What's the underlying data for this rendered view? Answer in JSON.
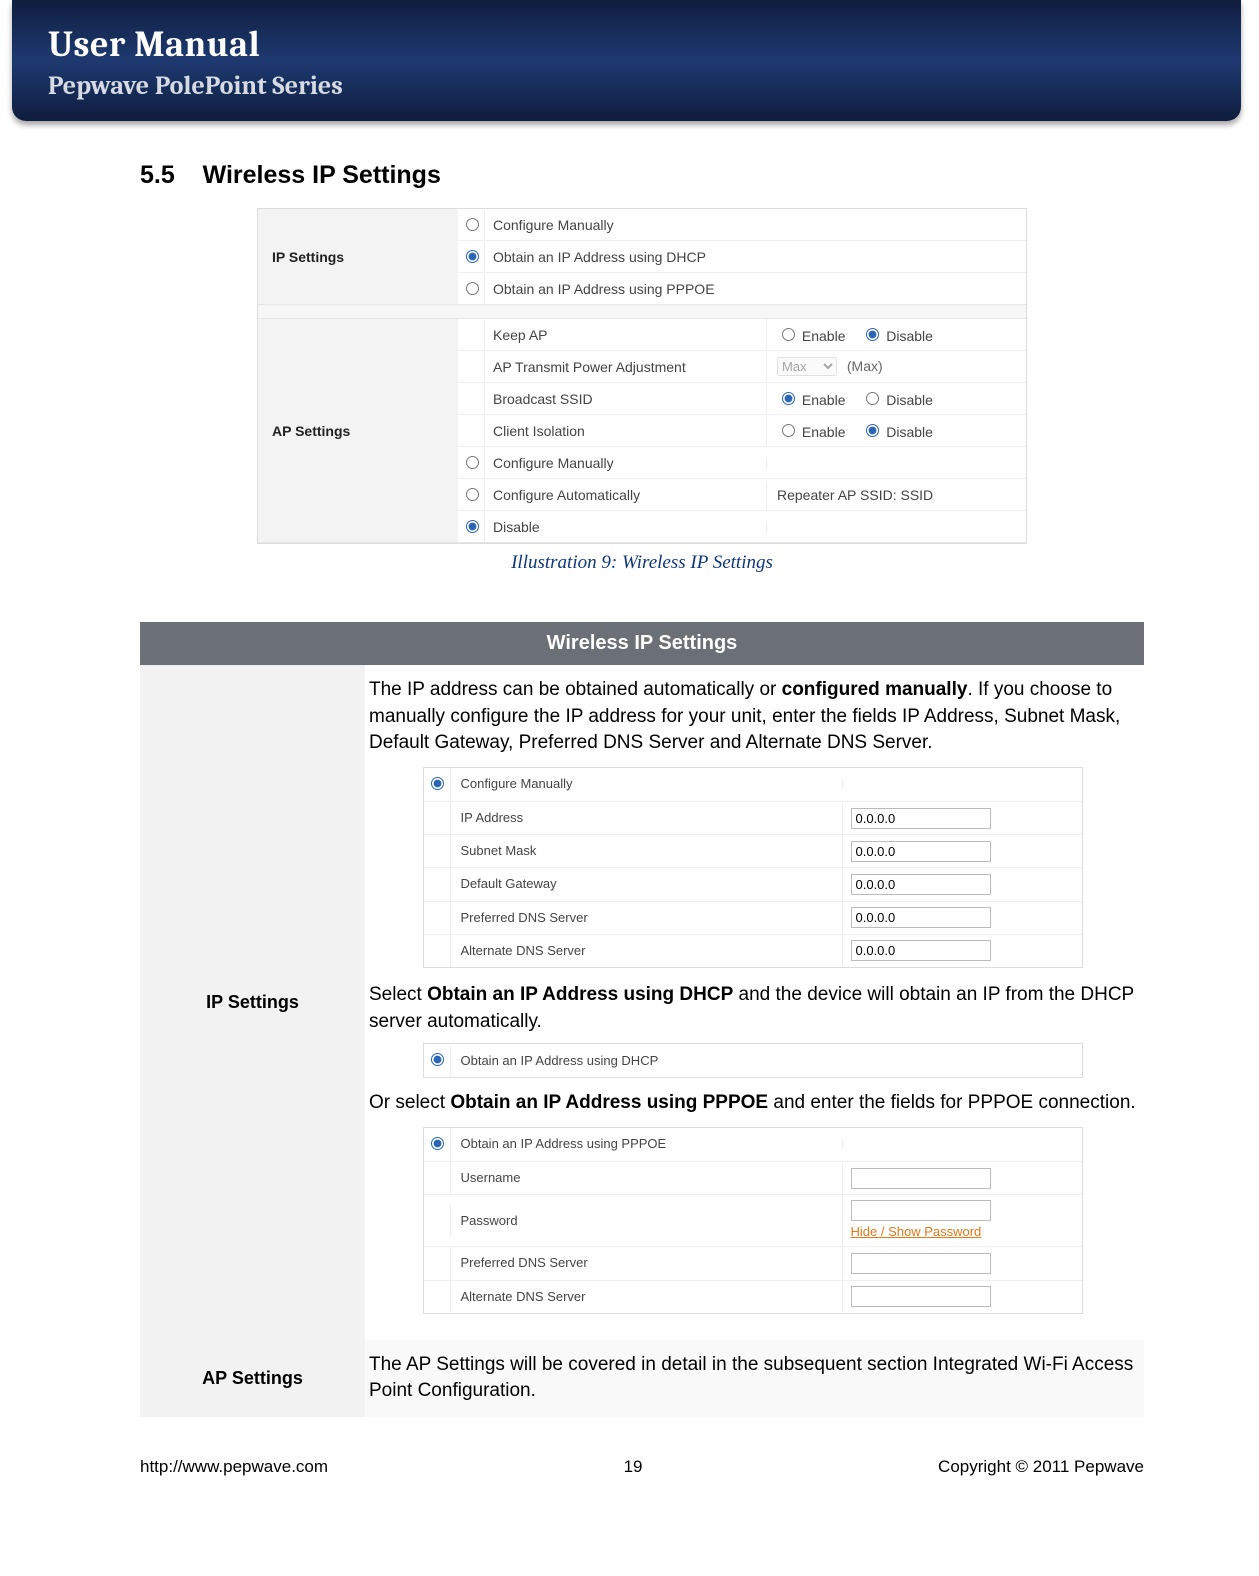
{
  "header": {
    "title": "User Manual",
    "subtitle": "Pepwave PolePoint Series"
  },
  "section": {
    "number": "5.5",
    "title": "Wireless IP Settings"
  },
  "illus": {
    "ip_settings_label": "IP Settings",
    "ap_settings_label": "AP Settings",
    "opts": {
      "configure_manually": "Configure Manually",
      "dhcp": "Obtain an IP Address using DHCP",
      "pppoe": "Obtain an IP Address using PPPOE",
      "keep_ap": "Keep AP",
      "ap_tx_power": "AP Transmit Power Adjustment",
      "broadcast_ssid": "Broadcast SSID",
      "client_isolation": "Client Isolation",
      "configure_auto": "Configure Automatically",
      "disable": "Disable"
    },
    "ctrls": {
      "enable": "Enable",
      "disable": "Disable",
      "max": "Max",
      "max_hint": "(Max)",
      "repeater_ssid": "Repeater AP SSID: SSID"
    }
  },
  "caption": "Illustration 9: Wireless IP Settings",
  "table": {
    "header": "Wireless IP Settings",
    "ip_settings_label": "IP Settings",
    "ap_settings_label": "AP Settings",
    "ip_desc_1a": "The IP address can be obtained automatically or ",
    "ip_desc_1b": "configured manually",
    "ip_desc_1c": ".  If you choose to manually configure the IP address for your unit, enter the fields IP Address, Subnet Mask, Default Gateway, Preferred DNS Server and Alternate DNS Server.",
    "ip_desc_2a": "Select ",
    "ip_desc_2b": "Obtain an IP Address using DHCP",
    "ip_desc_2c": " and the device will obtain an IP from the DHCP server automatically.",
    "ip_desc_3a": "Or select ",
    "ip_desc_3b": "Obtain an IP Address using PPPOE",
    "ip_desc_3c": " and enter the fields for PPPOE connection.",
    "ap_desc": "The AP Settings will be covered in detail in the subsequent section Integrated Wi-Fi Access Point Configuration."
  },
  "manual_panel": {
    "configure_manually": "Configure Manually",
    "ip_address": "IP Address",
    "subnet_mask": "Subnet Mask",
    "default_gateway": "Default Gateway",
    "pref_dns": "Preferred DNS Server",
    "alt_dns": "Alternate DNS Server",
    "val": "0.0.0.0"
  },
  "dhcp_panel": {
    "label": "Obtain an IP Address using DHCP"
  },
  "pppoe_panel": {
    "label": "Obtain an IP Address using PPPOE",
    "username": "Username",
    "password": "Password",
    "pwlink": "Hide / Show Password",
    "pref_dns": "Preferred DNS Server",
    "alt_dns": "Alternate DNS Server"
  },
  "footer": {
    "url": "http://www.pepwave.com",
    "page": "19",
    "copyright": "Copyright © 2011 Pepwave"
  }
}
